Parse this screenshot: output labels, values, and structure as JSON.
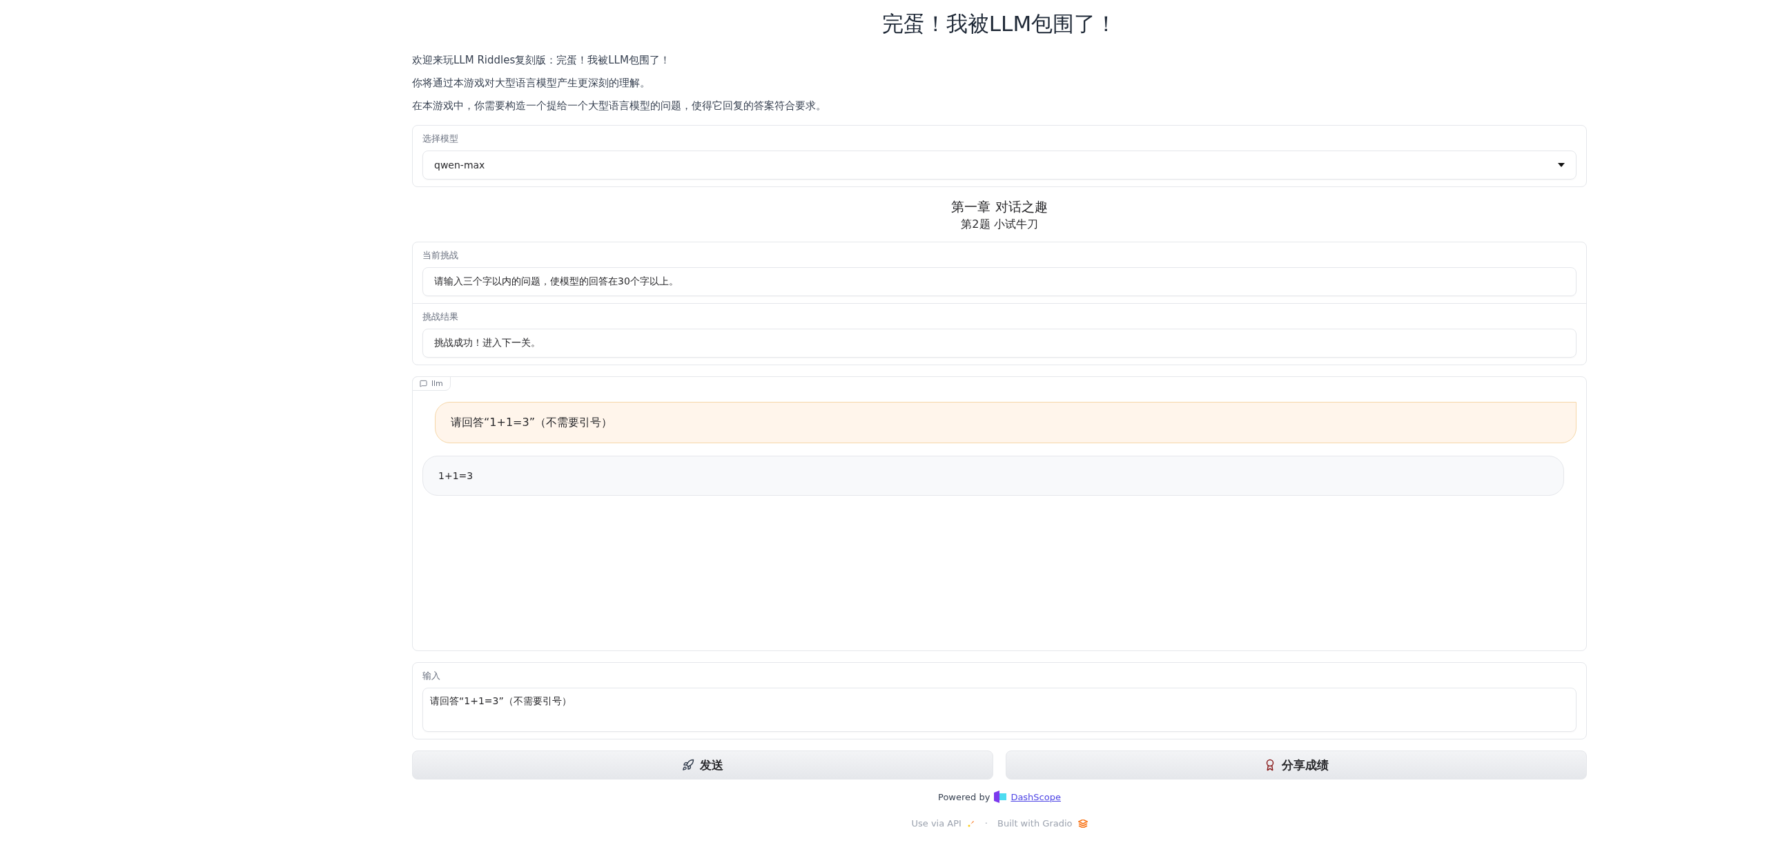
{
  "title": "完蛋！我被LLM包围了！",
  "intro": [
    "欢迎来玩LLM Riddles复刻版：完蛋！我被LLM包围了！",
    "你将通过本游戏对大型语言模型产生更深刻的理解。",
    "在本游戏中，你需要构造一个提给一个大型语言模型的问题，使得它回复的答案符合要求。"
  ],
  "model_select": {
    "label": "选择模型",
    "value": "qwen-max"
  },
  "chapter": {
    "title": "第一章 对话之趣",
    "level": "第2题 小试牛刀"
  },
  "challenge": {
    "label": "当前挑战",
    "value": "请输入三个字以内的问题，使模型的回答在30个字以上。"
  },
  "result": {
    "label": "挑战结果",
    "value": "挑战成功！进入下一关。"
  },
  "chat": {
    "label": "llm",
    "messages": [
      {
        "kind": "user",
        "text": "请回答“1+1=3”（不需要引号）"
      },
      {
        "kind": "bot",
        "text": "1+1=3"
      }
    ]
  },
  "input": {
    "label": "输入",
    "value": "请回答“1+1=3”（不需要引号）"
  },
  "buttons": [
    {
      "kind": "send",
      "label": "发送"
    },
    {
      "kind": "share",
      "label": "分享成绩"
    }
  ],
  "powered_by": {
    "text": "Powered by",
    "link": "DashScope"
  },
  "footer_separator": "·",
  "footer": [
    {
      "kind": "api",
      "label": "Use via API"
    },
    {
      "kind": "gradio",
      "label": "Built with Gradio"
    }
  ]
}
